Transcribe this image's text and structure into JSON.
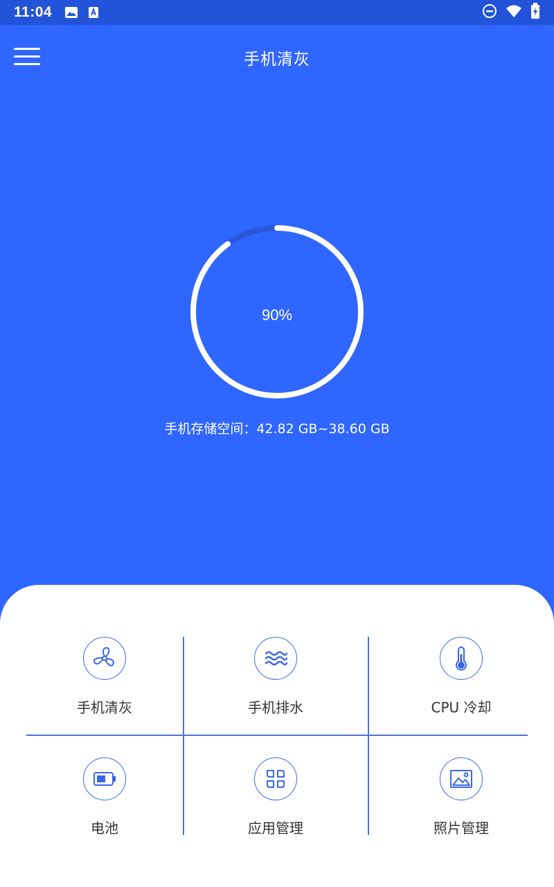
{
  "status_bar": {
    "time": "11:04",
    "left_icons": [
      "image-icon",
      "a-badge-icon"
    ],
    "right_icons": [
      "do-not-disturb-icon",
      "wifi-icon",
      "battery-charging-icon"
    ]
  },
  "header": {
    "title": "手机清灰",
    "menu_icon": "hamburger-menu-icon"
  },
  "gauge": {
    "percent_label": "90%",
    "percent_value": 90
  },
  "storage": {
    "text": "手机存储空间：42.82 GB~38.60 GB"
  },
  "features": [
    {
      "label": "手机清灰",
      "icon": "fan-icon"
    },
    {
      "label": "手机排水",
      "icon": "water-waves-icon"
    },
    {
      "label": "CPU 冷却",
      "icon": "thermometer-icon"
    },
    {
      "label": "电池",
      "icon": "battery-icon"
    },
    {
      "label": "应用管理",
      "icon": "apps-grid-icon"
    },
    {
      "label": "照片管理",
      "icon": "photo-icon"
    }
  ],
  "colors": {
    "status_bar": "#2353d9",
    "hero": "#2f66ff",
    "accent": "#3b66e4",
    "gauge_track": "#2a57d8",
    "text_dark": "#333333"
  }
}
